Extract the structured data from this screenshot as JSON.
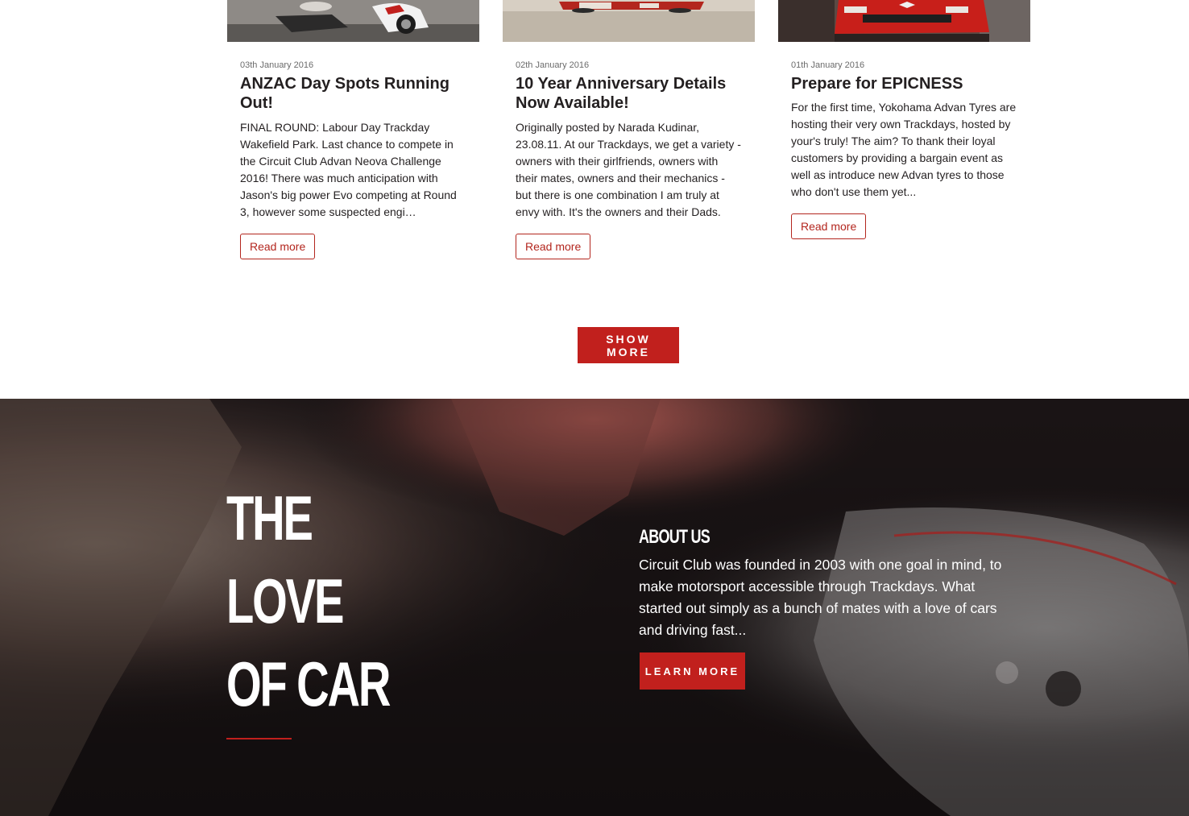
{
  "news": {
    "cards": [
      {
        "date": "03th January 2016",
        "title": "ANZAC Day Spots Running Out!",
        "excerpt": "FINAL ROUND: Labour Day Trackday Wakefield Park. Last chance to compete in the Circuit Club Advan Neova Challenge 2016! There was much anticipation with Jason's big power Evo competing at Round 3, however some suspected engi…",
        "read_more": "Read more"
      },
      {
        "date": "02th January 2016",
        "title": "10 Year Anniversary Details Now Available!",
        "excerpt": "Originally posted by Narada Kudinar, 23.08.11. At our Trackdays, we get a variety - owners with their girlfriends, owners with their mates, owners and their mechanics - but there is one combination I am truly at envy with. It's the owners and their Dads.",
        "read_more": "Read more"
      },
      {
        "date": "01th January 2016",
        "title": "Prepare for EPICNESS",
        "excerpt": "For the first time, Yokohama Advan Tyres are hosting their very own Trackdays, hosted by your's truly! The aim? To thank their loyal customers by providing a bargain event as well as introduce new Advan tyres to those who don't use them yet...",
        "read_more": "Read more"
      }
    ],
    "show_more": "SHOW MORE"
  },
  "about": {
    "headline_1": "THE",
    "headline_2": "LOVE",
    "headline_3": "OF CAR",
    "heading": "ABOUT US",
    "text": "Circuit Club was founded in 2003 with one goal in mind, to make motorsport accessible through Trackdays. What started out simply as a bunch of mates with a love of cars and driving fast...",
    "learn_more": "LEARN MORE"
  },
  "colors": {
    "accent": "#c1201d",
    "text": "#231f20",
    "dark_bg": "#1a1415"
  }
}
